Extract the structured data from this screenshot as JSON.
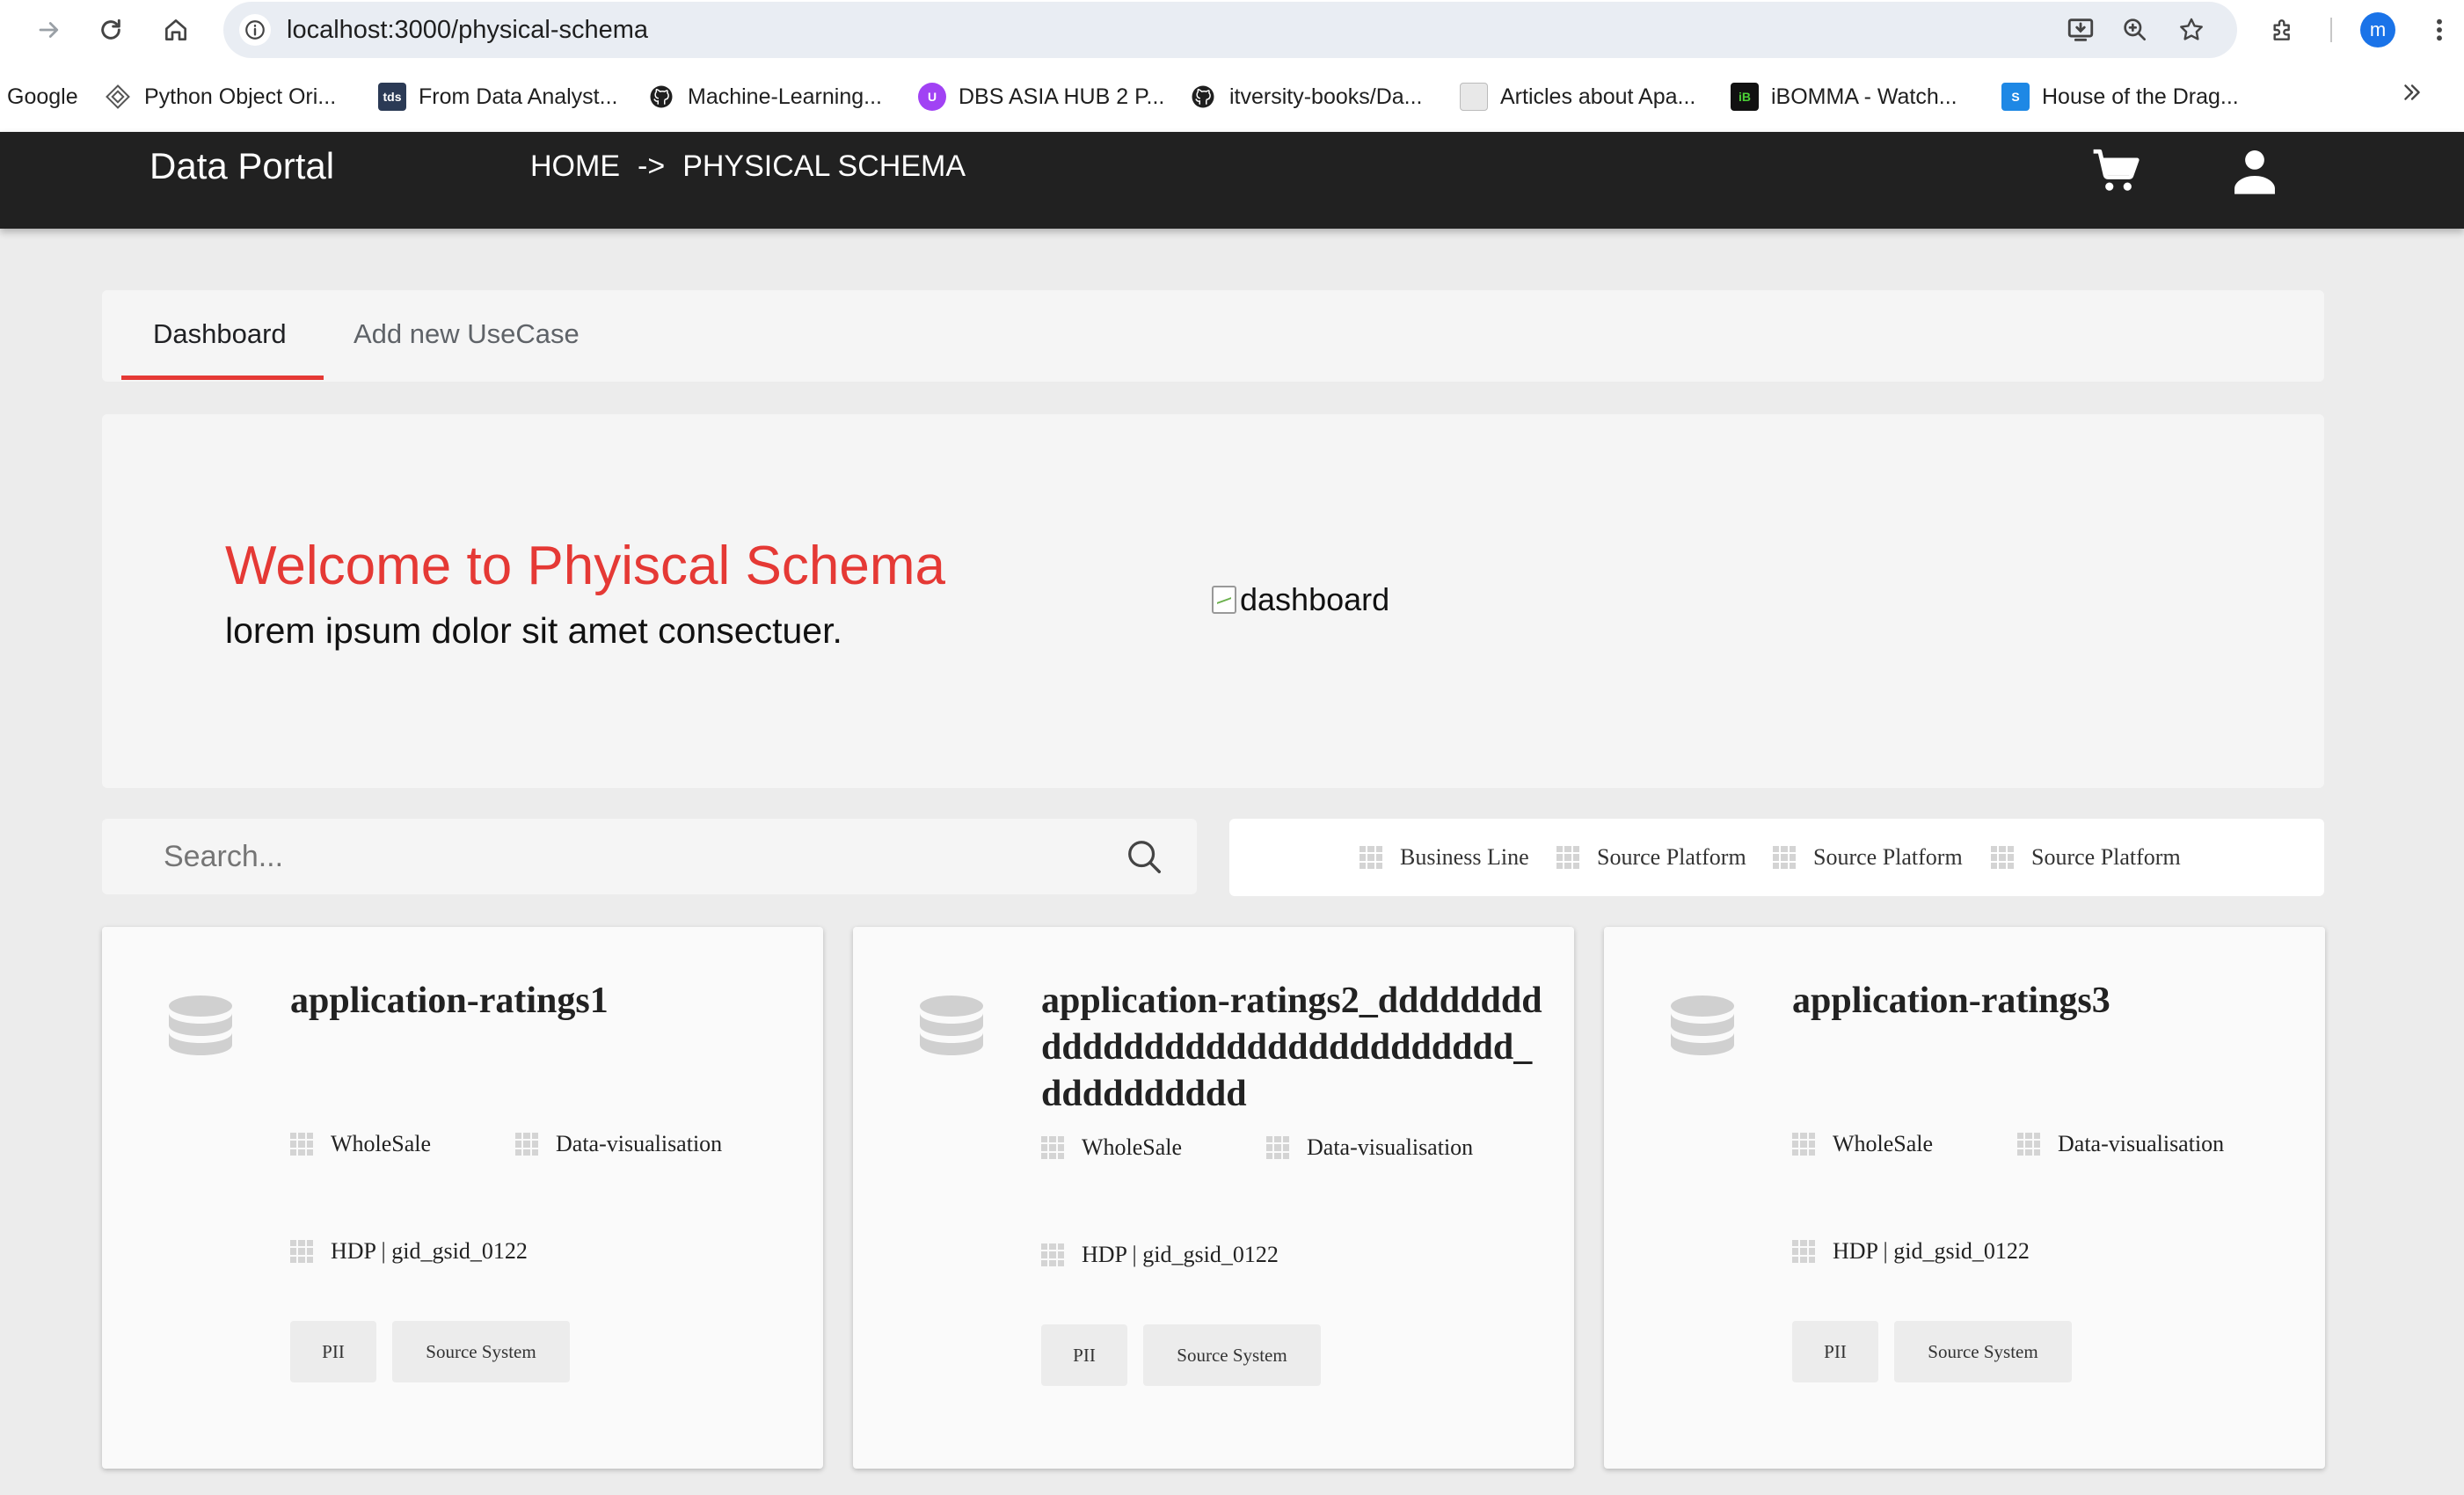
{
  "browser": {
    "url": "localhost:3000/physical-schema",
    "profile_initial": "m",
    "bookmarks": [
      {
        "label": "Google",
        "icon": "google-text"
      },
      {
        "label": "Python Object Ori...",
        "icon": "diamond-icon"
      },
      {
        "label": "From Data Analyst...",
        "icon": "tds-icon"
      },
      {
        "label": "Machine-Learning...",
        "icon": "github-icon"
      },
      {
        "label": "DBS ASIA HUB 2 P...",
        "icon": "u-icon"
      },
      {
        "label": "itversity-books/Da...",
        "icon": "github-icon"
      },
      {
        "label": "Articles about Apa...",
        "icon": "site-icon"
      },
      {
        "label": "iBOMMA - Watch...",
        "icon": "ib-icon"
      },
      {
        "label": "House of the Drag...",
        "icon": "s-icon"
      }
    ],
    "tds_text": "tds",
    "ib_text": "iB",
    "s_text": "S",
    "u_text": "U"
  },
  "app": {
    "title": "Data Portal",
    "breadcrumb": {
      "home": "HOME",
      "arrow": "->",
      "current": "PHYSICAL SCHEMA"
    }
  },
  "tabs": [
    {
      "label": "Dashboard",
      "active": true
    },
    {
      "label": "Add new UseCase",
      "active": false
    }
  ],
  "hero": {
    "title": "Welcome to Phyiscal Schema",
    "subtitle": "lorem ipsum dolor sit amet consectuer.",
    "image_alt": "dashboard"
  },
  "search": {
    "placeholder": "Search..."
  },
  "filters": [
    "Business Line",
    "Source Platform",
    "Source Platform",
    "Source Platform"
  ],
  "cards": [
    {
      "title": "application-ratings1",
      "business_line": "WholeSale",
      "category": "Data-visualisation",
      "source": "HDP | gid_gsid_0122",
      "chips": [
        "PII",
        "Source System"
      ]
    },
    {
      "title": "application-ratings2_ddddddddddddddddddddddddddddddd_dddddddddd",
      "business_line": "WholeSale",
      "category": "Data-visualisation",
      "source": "HDP | gid_gsid_0122",
      "chips": [
        "PII",
        "Source System"
      ]
    },
    {
      "title": "application-ratings3",
      "business_line": "WholeSale",
      "category": "Data-visualisation",
      "source": "HDP | gid_gsid_0122",
      "chips": [
        "PII",
        "Source System"
      ]
    }
  ],
  "colors": {
    "accent_red": "#e53935",
    "appbar": "#212121",
    "page_bg": "#ececec",
    "card_bg": "#fafafa"
  }
}
